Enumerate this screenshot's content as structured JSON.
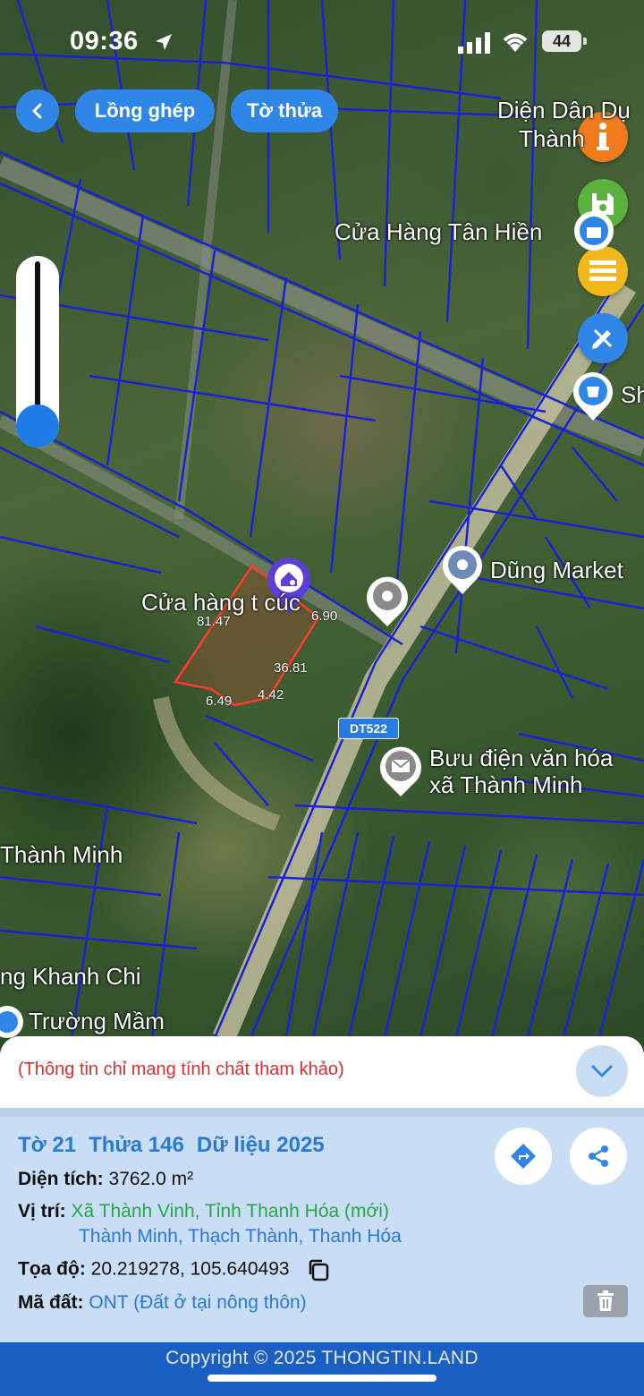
{
  "status_bar": {
    "time": "09:36",
    "battery": "44"
  },
  "toolbar": {
    "merge_label": "Lồng ghép",
    "sheet_label": "Tờ thửa"
  },
  "map": {
    "labels": {
      "dien_dan_du": "Diện Dân Dụ",
      "thanh": "Thành",
      "cua_hang_tan_hien": "Cửa Hàng Tân Hiền",
      "sh": "Sh",
      "dung_market": "Dũng Market",
      "cua_hang_cuc": "Cửa hàng t  cúc",
      "buu_dien_1": "Bưu điện văn hóa",
      "buu_dien_2": "xã Thành Minh",
      "thanh_minh": "Thành Minh",
      "khanh_chi": "ng Khanh Chi",
      "truong_mam": "Trường Mầm"
    },
    "dimensions": [
      "81.47",
      "6.90",
      "36.81",
      "6.49",
      "4.42"
    ],
    "road_sign": "DT522"
  },
  "parcel": {
    "notice": "(Thông tin chỉ mang tính chất tham khảo)",
    "sheet": "Tờ 21",
    "plot": "Thửa 146",
    "data_year": "Dữ liệu 2025",
    "area_label": "Diện tích:",
    "area_value": "3762.0 m²",
    "location_label": "Vị trí:",
    "location_new": "Xã Thành Vinh, Tỉnh Thanh Hóa (mới)",
    "location_old": "Thành Minh, Thạch Thành, Thanh Hóa",
    "coords_label": "Tọa độ:",
    "coords_value": "20.219278, 105.640493",
    "land_code_label": "Mã đất:",
    "land_code_value": "ONT (Đất ở tại nông thôn)"
  },
  "footer": {
    "copyright": "Copyright © 2025 THONGTIN.LAND"
  },
  "colors": {
    "accent": "#2f86e6",
    "parcel_outline": "#ff3b30",
    "boundary_lines": "#1a22d6"
  }
}
